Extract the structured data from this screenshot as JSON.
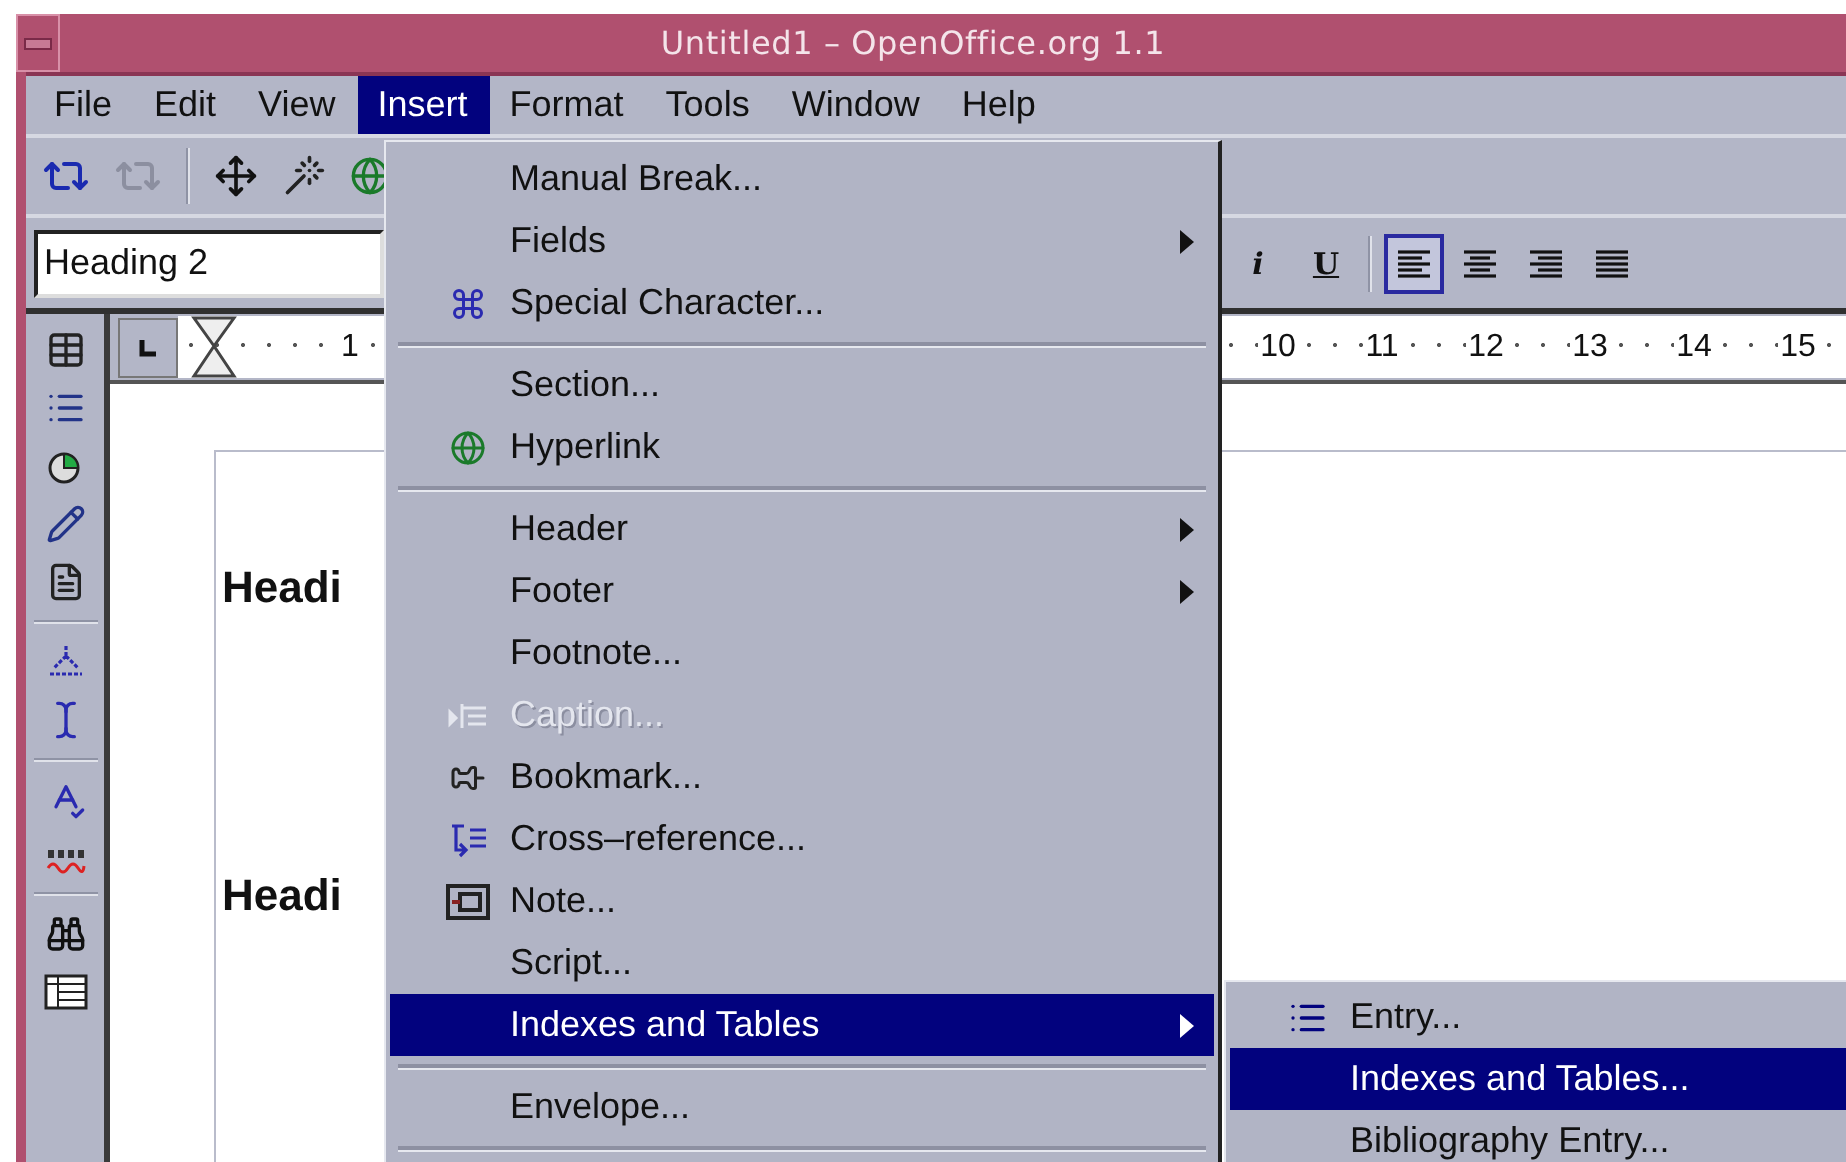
{
  "window": {
    "title": "Untitled1 – OpenOffice.org 1.1"
  },
  "menubar": [
    {
      "label": "File",
      "selected": false
    },
    {
      "label": "Edit",
      "selected": false
    },
    {
      "label": "View",
      "selected": false
    },
    {
      "label": "Insert",
      "selected": true
    },
    {
      "label": "Format",
      "selected": false
    },
    {
      "label": "Tools",
      "selected": false
    },
    {
      "label": "Window",
      "selected": false
    },
    {
      "label": "Help",
      "selected": false
    }
  ],
  "style_field": {
    "value": "Heading 2"
  },
  "format_toolbar": {
    "italic": "i",
    "underline": "U",
    "align": [
      {
        "selected": true
      },
      {
        "selected": false
      },
      {
        "selected": false
      },
      {
        "selected": false
      }
    ]
  },
  "ruler": {
    "left_labels": [
      "1"
    ],
    "right_labels": [
      "10",
      "11",
      "12",
      "13",
      "14",
      "15"
    ]
  },
  "document": {
    "headings": [
      "Headi",
      "Headi"
    ]
  },
  "insert_menu": [
    {
      "kind": "item",
      "label": "Manual Break...",
      "submenu": false,
      "disabled": false,
      "selected": false
    },
    {
      "kind": "item",
      "label": "Fields",
      "submenu": true,
      "disabled": false,
      "selected": false
    },
    {
      "kind": "item",
      "label": "Special Character...",
      "submenu": false,
      "disabled": false,
      "selected": false
    },
    {
      "kind": "separator"
    },
    {
      "kind": "item",
      "label": "Section...",
      "submenu": false,
      "disabled": false,
      "selected": false
    },
    {
      "kind": "item",
      "label": "Hyperlink",
      "submenu": false,
      "disabled": false,
      "selected": false
    },
    {
      "kind": "separator"
    },
    {
      "kind": "item",
      "label": "Header",
      "submenu": true,
      "disabled": false,
      "selected": false
    },
    {
      "kind": "item",
      "label": "Footer",
      "submenu": true,
      "disabled": false,
      "selected": false
    },
    {
      "kind": "item",
      "label": "Footnote...",
      "submenu": false,
      "disabled": false,
      "selected": false
    },
    {
      "kind": "item",
      "label": "Caption...",
      "submenu": false,
      "disabled": true,
      "selected": false
    },
    {
      "kind": "item",
      "label": "Bookmark...",
      "submenu": false,
      "disabled": false,
      "selected": false
    },
    {
      "kind": "item",
      "label": "Cross–reference...",
      "submenu": false,
      "disabled": false,
      "selected": false
    },
    {
      "kind": "item",
      "label": "Note...",
      "submenu": false,
      "disabled": false,
      "selected": false
    },
    {
      "kind": "item",
      "label": "Script...",
      "submenu": false,
      "disabled": false,
      "selected": false
    },
    {
      "kind": "item",
      "label": "Indexes and Tables",
      "submenu": true,
      "disabled": false,
      "selected": true
    },
    {
      "kind": "separator"
    },
    {
      "kind": "item",
      "label": "Envelope...",
      "submenu": false,
      "disabled": false,
      "selected": false
    },
    {
      "kind": "separator"
    }
  ],
  "indexes_submenu": [
    {
      "label": "Entry...",
      "selected": false
    },
    {
      "label": "Indexes and Tables...",
      "selected": true
    },
    {
      "label": "Bibliography Entry...",
      "selected": false
    }
  ]
}
